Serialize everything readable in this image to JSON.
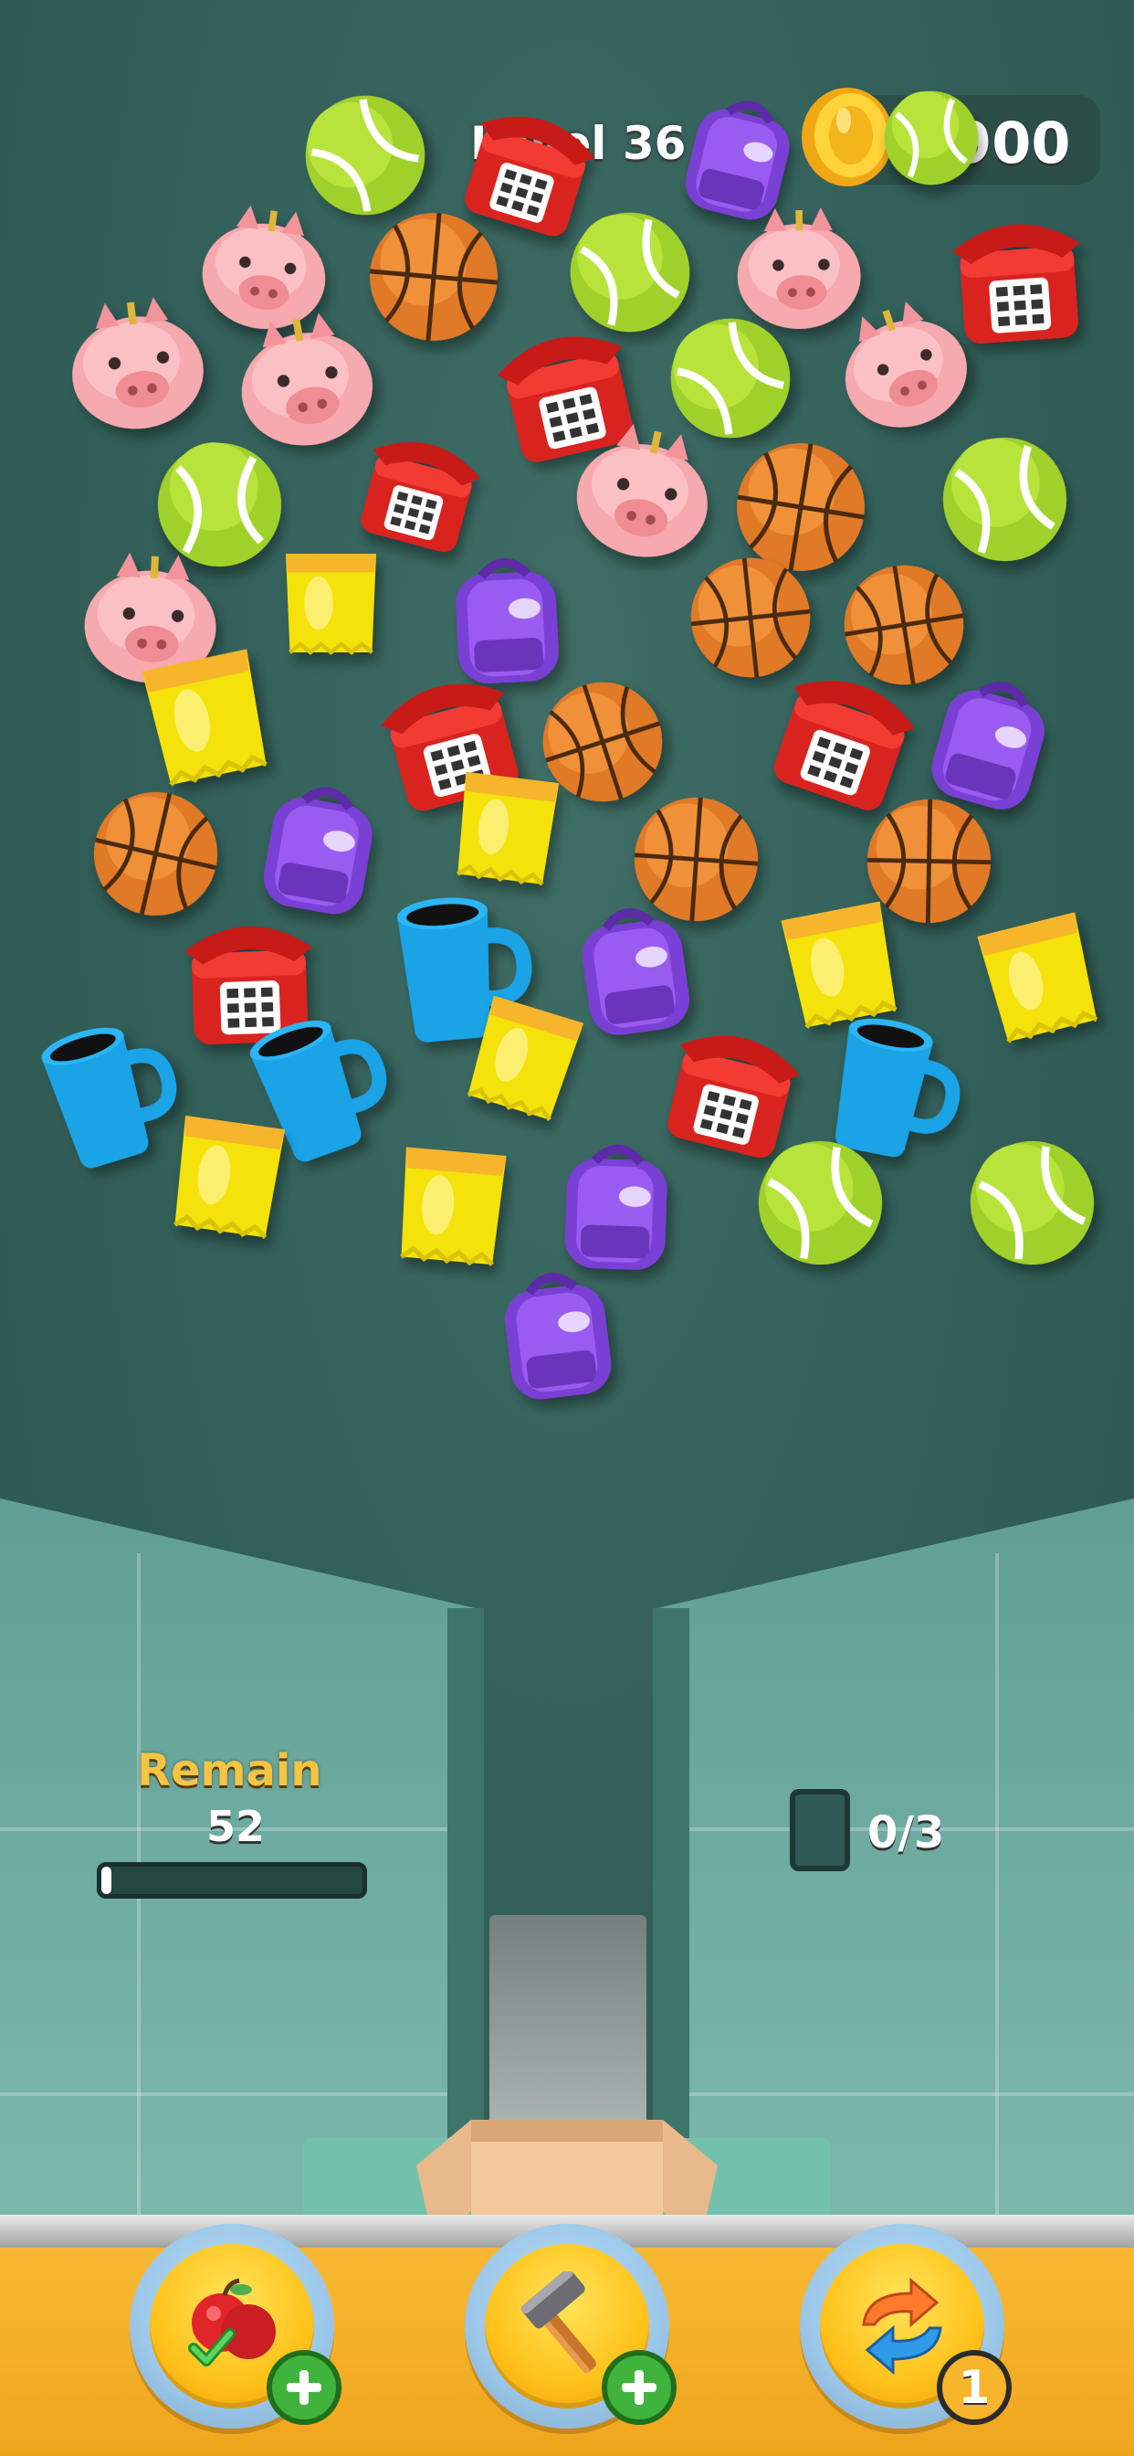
{
  "hud": {
    "level_label": "Level 36",
    "coins": "1900"
  },
  "board": {
    "items": [
      {
        "type": "tennis-ball"
      },
      {
        "type": "telephone"
      },
      {
        "type": "backpack"
      },
      {
        "type": "tennis-ball"
      },
      {
        "type": "piggy-bank"
      },
      {
        "type": "basketball"
      },
      {
        "type": "tennis-ball"
      },
      {
        "type": "piggy-bank"
      },
      {
        "type": "telephone"
      },
      {
        "type": "piggy-bank"
      },
      {
        "type": "piggy-bank"
      },
      {
        "type": "telephone"
      },
      {
        "type": "tennis-ball"
      },
      {
        "type": "piggy-bank"
      },
      {
        "type": "tennis-ball"
      },
      {
        "type": "telephone"
      },
      {
        "type": "piggy-bank"
      },
      {
        "type": "basketball"
      },
      {
        "type": "tennis-ball"
      },
      {
        "type": "piggy-bank"
      },
      {
        "type": "chips-bag"
      },
      {
        "type": "backpack"
      },
      {
        "type": "basketball"
      },
      {
        "type": "basketball"
      },
      {
        "type": "chips-bag"
      },
      {
        "type": "telephone"
      },
      {
        "type": "basketball"
      },
      {
        "type": "telephone"
      },
      {
        "type": "backpack"
      },
      {
        "type": "basketball"
      },
      {
        "type": "backpack"
      },
      {
        "type": "chips-bag"
      },
      {
        "type": "basketball"
      },
      {
        "type": "basketball"
      },
      {
        "type": "telephone"
      },
      {
        "type": "mug"
      },
      {
        "type": "backpack"
      },
      {
        "type": "chips-bag"
      },
      {
        "type": "chips-bag"
      },
      {
        "type": "mug"
      },
      {
        "type": "mug"
      },
      {
        "type": "chips-bag"
      },
      {
        "type": "telephone"
      },
      {
        "type": "mug"
      },
      {
        "type": "chips-bag"
      },
      {
        "type": "chips-bag"
      },
      {
        "type": "backpack"
      },
      {
        "type": "tennis-ball"
      },
      {
        "type": "tennis-ball"
      },
      {
        "type": "backpack"
      }
    ]
  },
  "remain": {
    "label": "Remain",
    "count": "52",
    "progress": 0.04
  },
  "tray": {
    "count_text": "0/3"
  },
  "boosters": {
    "fruit": {
      "icon": "apples-check-icon",
      "badge": "plus"
    },
    "hammer": {
      "icon": "hammer-icon",
      "badge": "plus"
    },
    "shuffle": {
      "icon": "shuffle-arrows-icon",
      "badge": "1"
    }
  },
  "colors": {
    "background": "#33605a",
    "bottom_bar": "#f5ad27",
    "remain_label": "#f4c542"
  }
}
